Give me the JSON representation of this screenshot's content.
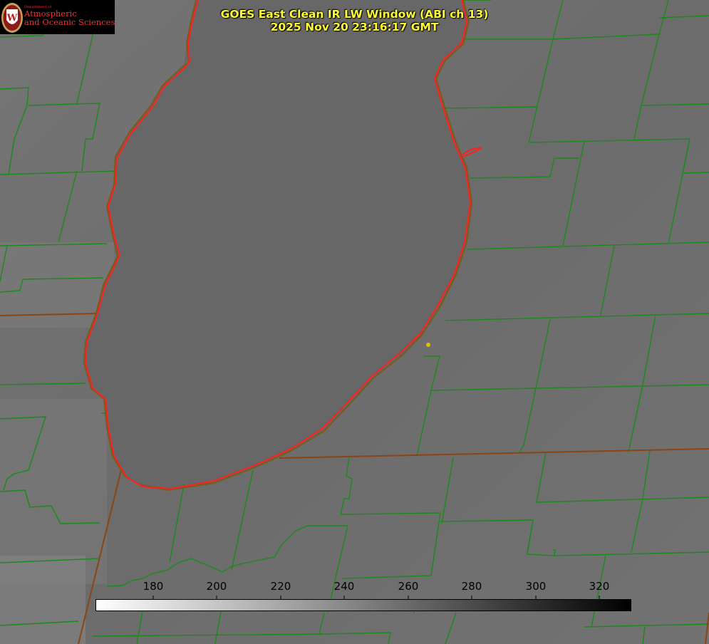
{
  "title": {
    "line1": "GOES East Clean IR LW Window (ABI ch 13)",
    "line2": "2025 Nov 20 23:16:17 GMT"
  },
  "logo": {
    "department": "Department of",
    "line1": "Atmospheric",
    "line2": "and Oceanic Sciences",
    "seal_letter": "W"
  },
  "colorbar": {
    "ticks": [
      "180",
      "200",
      "220",
      "240",
      "260",
      "280",
      "300",
      "320"
    ],
    "gradient_start": "#ffffff",
    "gradient_end": "#000000"
  },
  "colors": {
    "county_lines": "#1a8a1a",
    "state_lines": "#8b4513",
    "lake_outline": "#ff2020",
    "marker": "#e0c000",
    "title": "#ffff33",
    "logo_red": "#e8343c"
  },
  "map": {
    "feature": "lake-michigan",
    "marker": "city-dot"
  }
}
